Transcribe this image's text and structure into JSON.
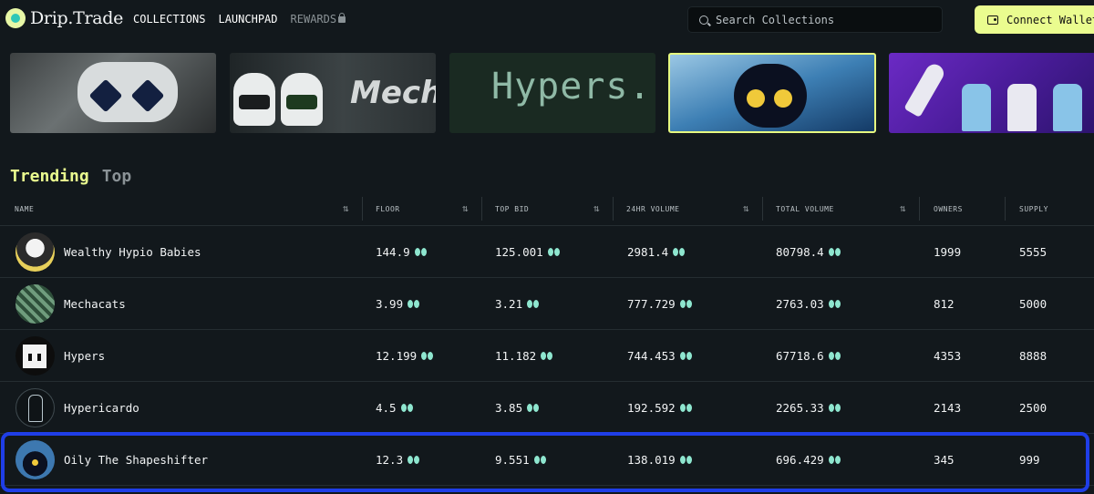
{
  "app": {
    "logo_text": "Drip.Trade"
  },
  "nav": {
    "collections": "COLLECTIONS",
    "launchpad": "LAUNCHPAD",
    "rewards": "REWARDS"
  },
  "search": {
    "placeholder": "Search Collections"
  },
  "wallet": {
    "connect_label": "Connect Wallet"
  },
  "banners": {
    "mechacats_text": "Mecha",
    "hypers_text": "Hypers."
  },
  "tabs": {
    "trending": "Trending",
    "top": "Top"
  },
  "table": {
    "columns": [
      "NAME",
      "FLOOR",
      "TOP BID",
      "24HR VOLUME",
      "TOTAL VOLUME",
      "OWNERS",
      "SUPPLY"
    ],
    "rows": [
      {
        "name": "Wealthy Hypio Babies",
        "floor": "144.9",
        "top_bid": "125.001",
        "vol_24h": "2981.4",
        "total_volume": "80798.4",
        "owners": "1999",
        "supply": "5555"
      },
      {
        "name": "Mechacats",
        "floor": "3.99",
        "top_bid": "3.21",
        "vol_24h": "777.729",
        "total_volume": "2763.03",
        "owners": "812",
        "supply": "5000"
      },
      {
        "name": "Hypers",
        "floor": "12.199",
        "top_bid": "11.182",
        "vol_24h": "744.453",
        "total_volume": "67718.6",
        "owners": "4353",
        "supply": "8888"
      },
      {
        "name": "Hypericardo",
        "floor": "4.5",
        "top_bid": "3.85",
        "vol_24h": "192.592",
        "total_volume": "2265.33",
        "owners": "2143",
        "supply": "2500"
      },
      {
        "name": "Oily The Shapeshifter",
        "floor": "12.3",
        "top_bid": "9.551",
        "vol_24h": "138.019",
        "total_volume": "696.429",
        "owners": "345",
        "supply": "999"
      }
    ]
  },
  "colors": {
    "accent": "#eafc8f",
    "background": "#12181c",
    "highlight_border": "#1f3ee8",
    "token_icon": "#8ee6cf"
  },
  "icons": {
    "currency": "hype-token-icon",
    "sort": "sort-arrows-icon",
    "search": "search-icon",
    "wallet": "wallet-icon",
    "lock": "lock-icon"
  }
}
